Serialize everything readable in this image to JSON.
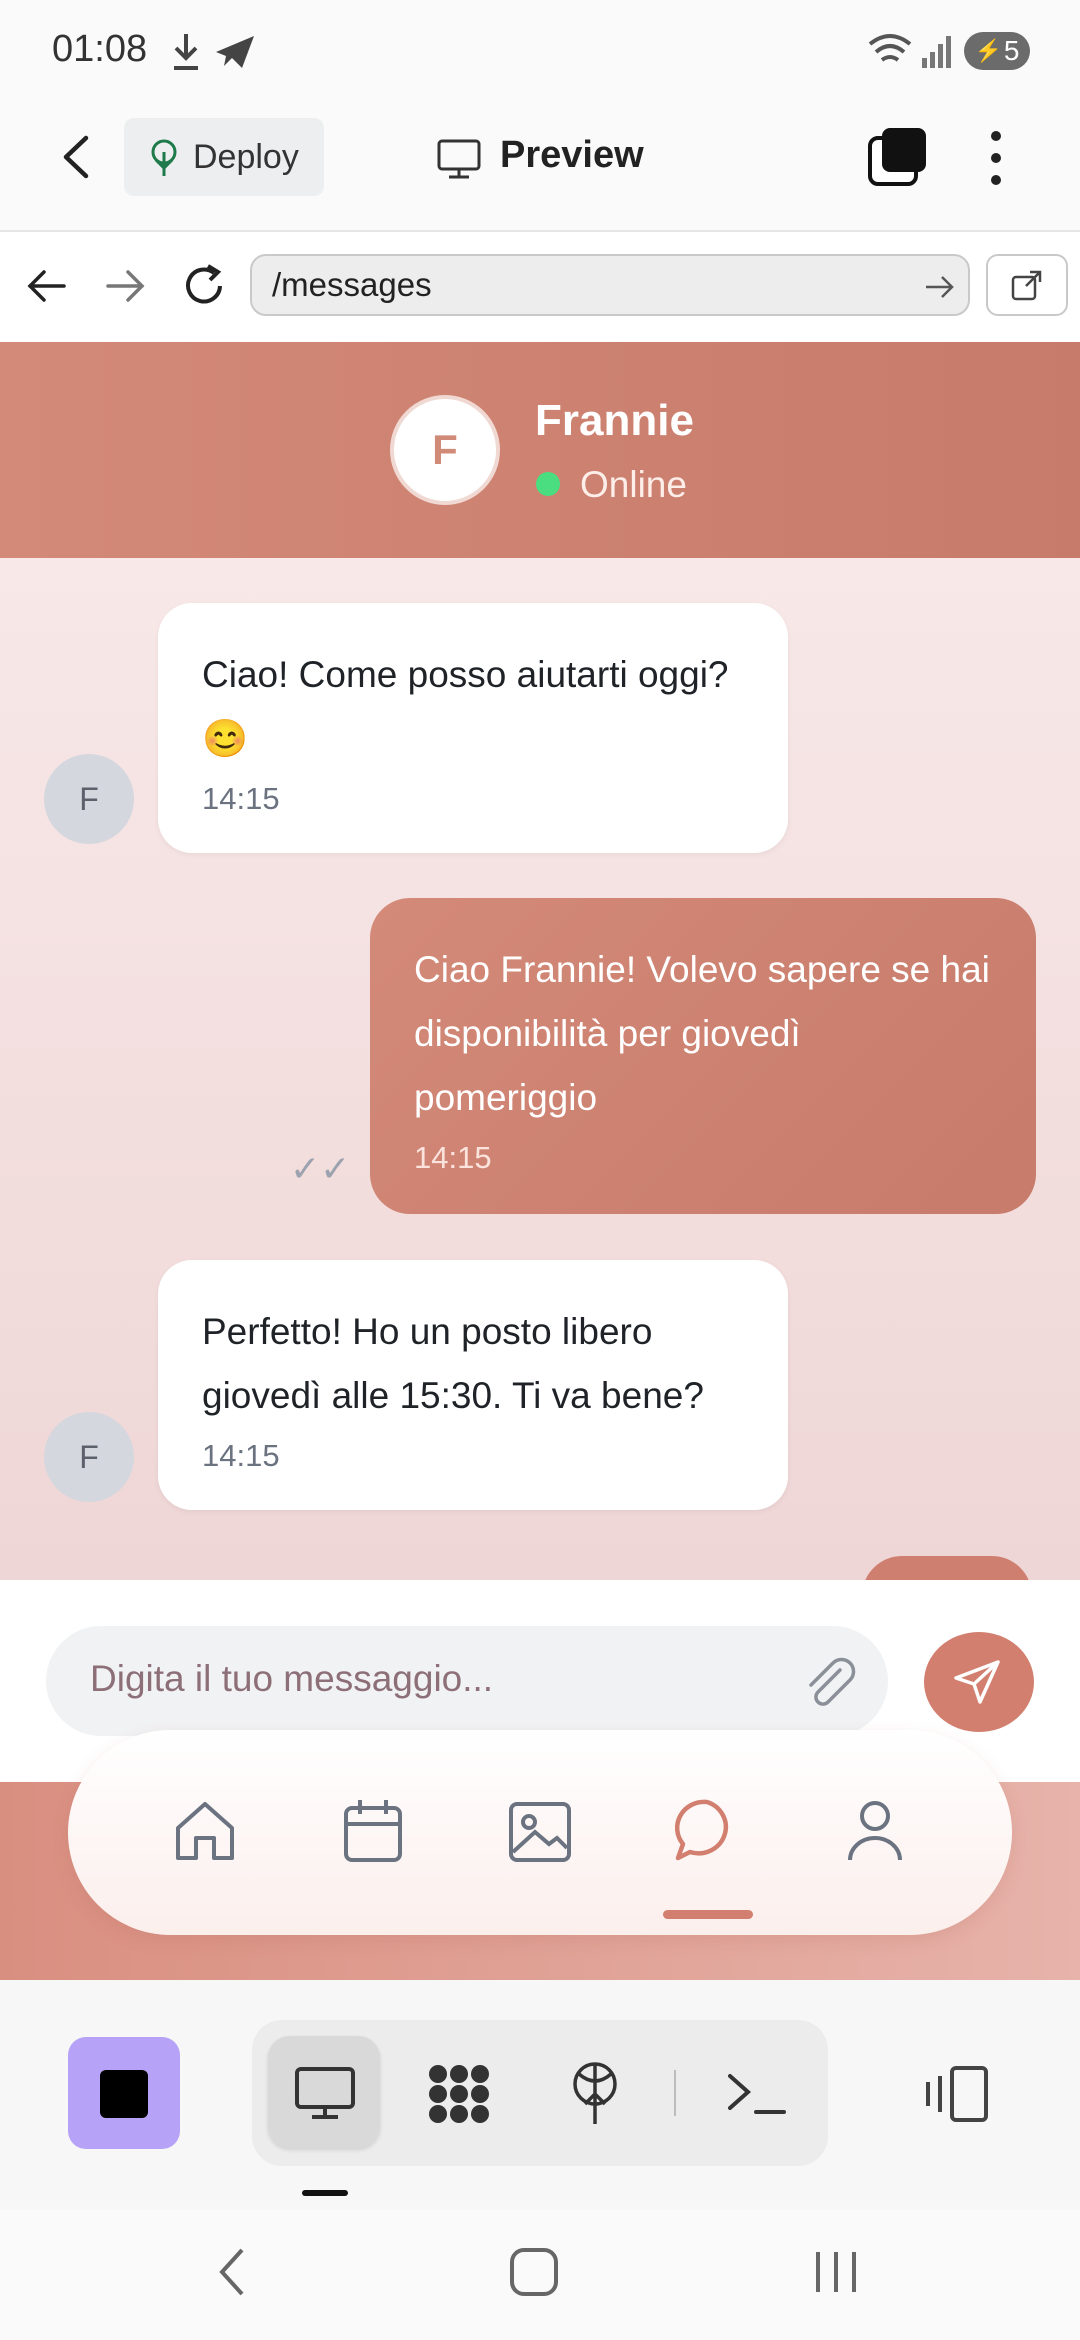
{
  "status_bar": {
    "time": "01:08",
    "battery": "5"
  },
  "app_header": {
    "deploy_label": "Deploy",
    "preview_label": "Preview"
  },
  "browser": {
    "url": "/messages"
  },
  "chat_header": {
    "avatar_letter": "F",
    "contact_name": "Frannie",
    "status": "Online"
  },
  "messages": [
    {
      "direction": "in",
      "avatar": "F",
      "text": "Ciao! Come posso aiutarti oggi? 😊",
      "time": "14:15"
    },
    {
      "direction": "out",
      "text": "Ciao Frannie! Volevo sapere se hai disponibilità per giovedì pomeriggio",
      "time": "14:15",
      "read_mark": "✓✓"
    },
    {
      "direction": "in",
      "avatar": "F",
      "text": "Perfetto! Ho un posto libero giovedì alle 15:30. Ti va bene?",
      "time": "14:15"
    }
  ],
  "composer": {
    "placeholder": "Digita il tuo messaggio..."
  },
  "app_nav": {
    "items": [
      "home-icon",
      "calendar-icon",
      "image-icon",
      "chat-icon",
      "profile-icon"
    ],
    "active": "chat-icon"
  },
  "colors": {
    "accent": "#d27f6f",
    "header": "#c77b6b",
    "online": "#4ade80",
    "stop": "#b6a3f7"
  }
}
